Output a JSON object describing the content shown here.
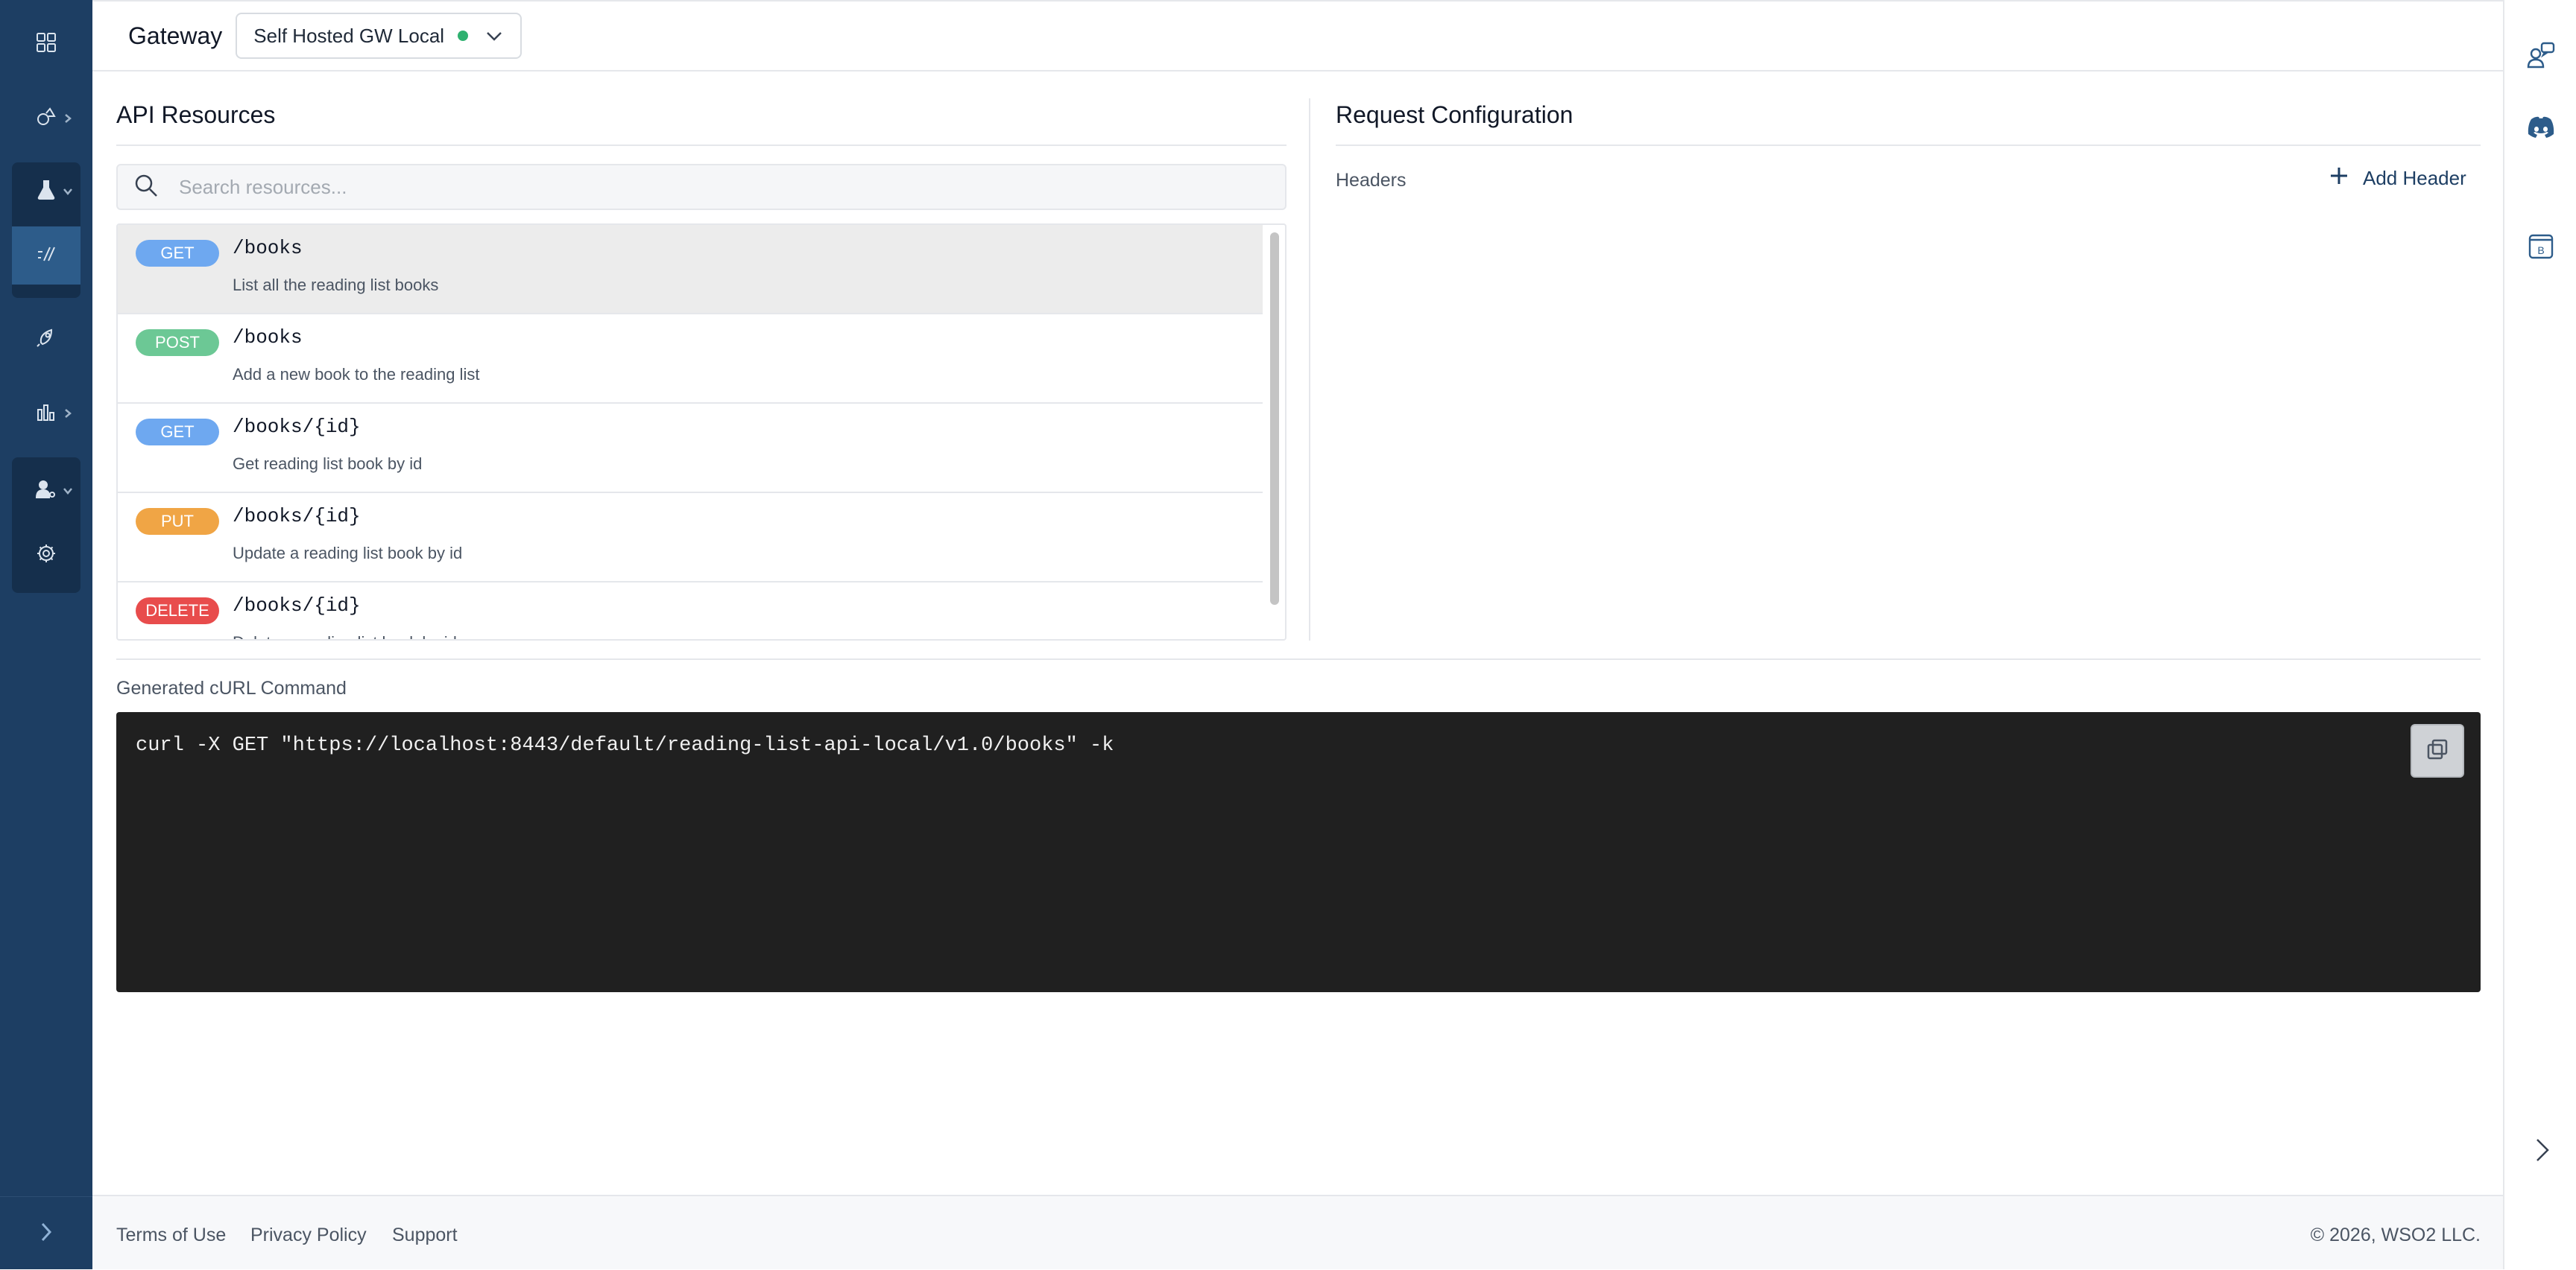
{
  "topbar": {
    "gateway_label": "Gateway",
    "gateway_value": "Self Hosted GW Local",
    "gateway_status_color": "#2fb170"
  },
  "sidebar": {
    "items": [
      {
        "name": "dashboard-icon"
      },
      {
        "name": "develop-icon"
      },
      {
        "name": "test-flask-icon"
      },
      {
        "name": "api-test-console-icon"
      },
      {
        "name": "deploy-rocket-icon"
      },
      {
        "name": "analytics-chart-icon"
      },
      {
        "name": "admin-users-icon"
      },
      {
        "name": "settings-gear-icon"
      }
    ],
    "accent": "#1d3e63"
  },
  "api_resources": {
    "title": "API Resources",
    "search_placeholder": "Search resources...",
    "items": [
      {
        "method": "GET",
        "path": "/books",
        "description": "List all the reading list books",
        "color": "#6ea8f0"
      },
      {
        "method": "POST",
        "path": "/books",
        "description": "Add a new book to the reading list",
        "color": "#6cc895"
      },
      {
        "method": "GET",
        "path": "/books/{id}",
        "description": "Get reading list book by id",
        "color": "#6ea8f0"
      },
      {
        "method": "PUT",
        "path": "/books/{id}",
        "description": "Update a reading list book by id",
        "color": "#f0a545"
      },
      {
        "method": "DELETE",
        "path": "/books/{id}",
        "description": "Delete a reading list book by id",
        "color": "#e84c4c"
      }
    ]
  },
  "request_config": {
    "title": "Request Configuration",
    "headers_label": "Headers",
    "add_header_label": "Add Header"
  },
  "curl": {
    "label": "Generated cURL Command",
    "command": "curl -X GET \"https://localhost:8443/default/reading-list-api-local/v1.0/books\" -k"
  },
  "footer": {
    "terms": "Terms of Use",
    "privacy": "Privacy Policy",
    "support": "Support",
    "copyright": "© 2026, WSO2 LLC."
  }
}
